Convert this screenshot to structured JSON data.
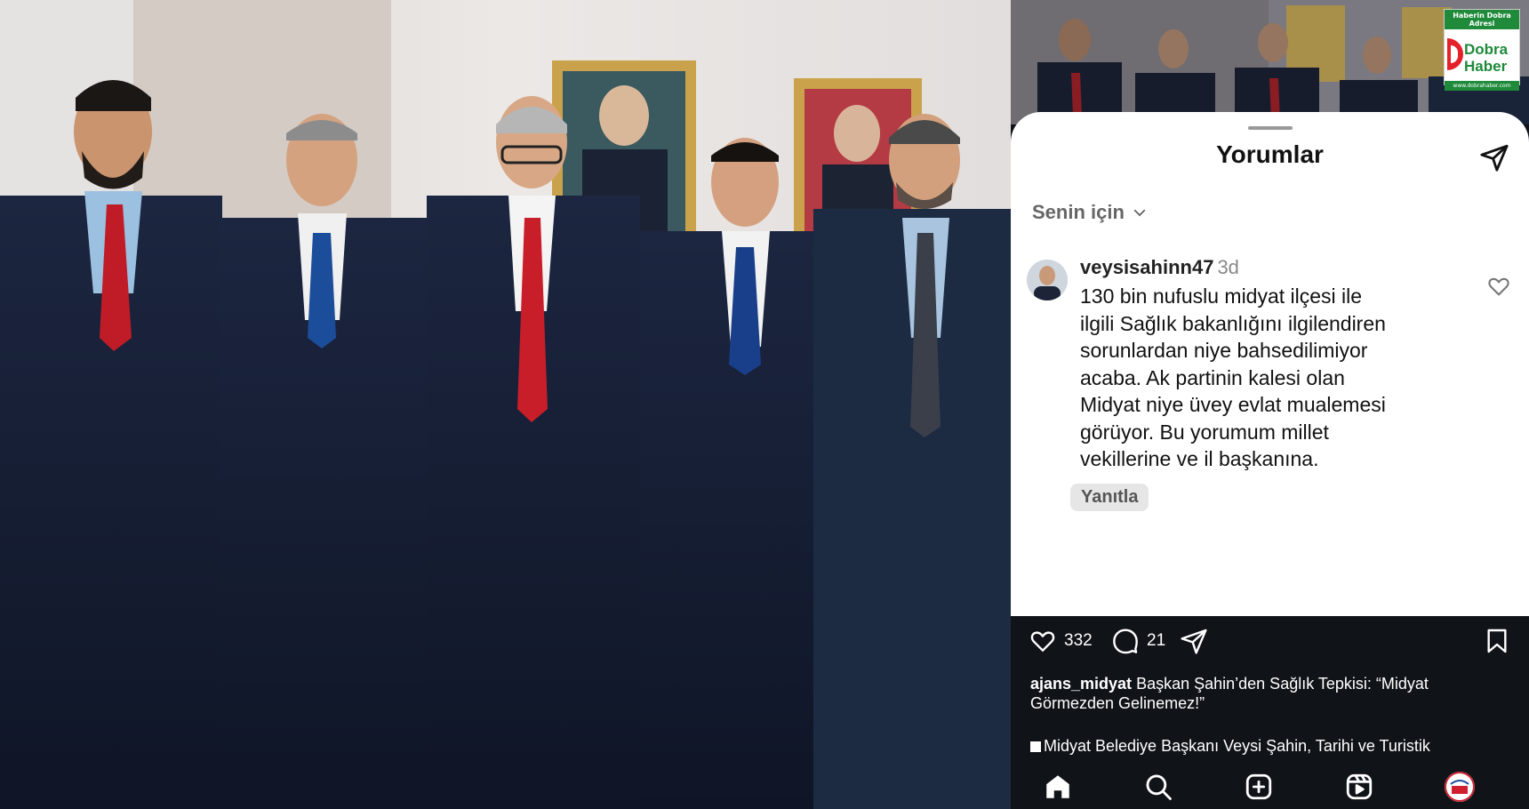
{
  "logo": {
    "tagline": "Haberin Dobra Adresi",
    "name_line1": "Dobra",
    "name_line2": "Haber",
    "url": "www.dobrahaber.com"
  },
  "comments_sheet": {
    "title": "Yorumlar",
    "share_icon": "paper-plane-icon",
    "filter_label": "Senin için",
    "filter_icon": "chevron-down-icon"
  },
  "comment": {
    "username": "veysisahinn47",
    "age": "3d",
    "text": "130 bin nufuslu midyat ilçesi  ile\nilgili  Sağlık bakanlığını ilgilendiren\nsorunlardan niye bahsedilimiyor\nacaba. Ak partinin kalesi olan\nMidyat niye üvey evlat mualemesi\ngörüyor. Bu yorumum  millet\nvekillerine ve il başkanına.",
    "reply_label": "Yanıtla",
    "like_icon": "heart-outline-icon"
  },
  "actions": {
    "likes": "332",
    "comments": "21"
  },
  "caption": {
    "username": "ajans_midyat",
    "text": "Başkan Şahin’den Sağlık Tepkisi: “Midyat Görmezden Gelinemez!”",
    "second_line": "Midyat Belediye Başkanı Veysi Şahin, Tarihi ve Turistik"
  },
  "nav": [
    "home-icon",
    "search-icon",
    "add-post-icon",
    "reels-icon",
    "profile-icon"
  ],
  "colors": {
    "dark_bg": "#101419",
    "sheet_bg": "#ffffff",
    "logo_green": "#1e8a3a",
    "logo_red": "#e4202a"
  }
}
